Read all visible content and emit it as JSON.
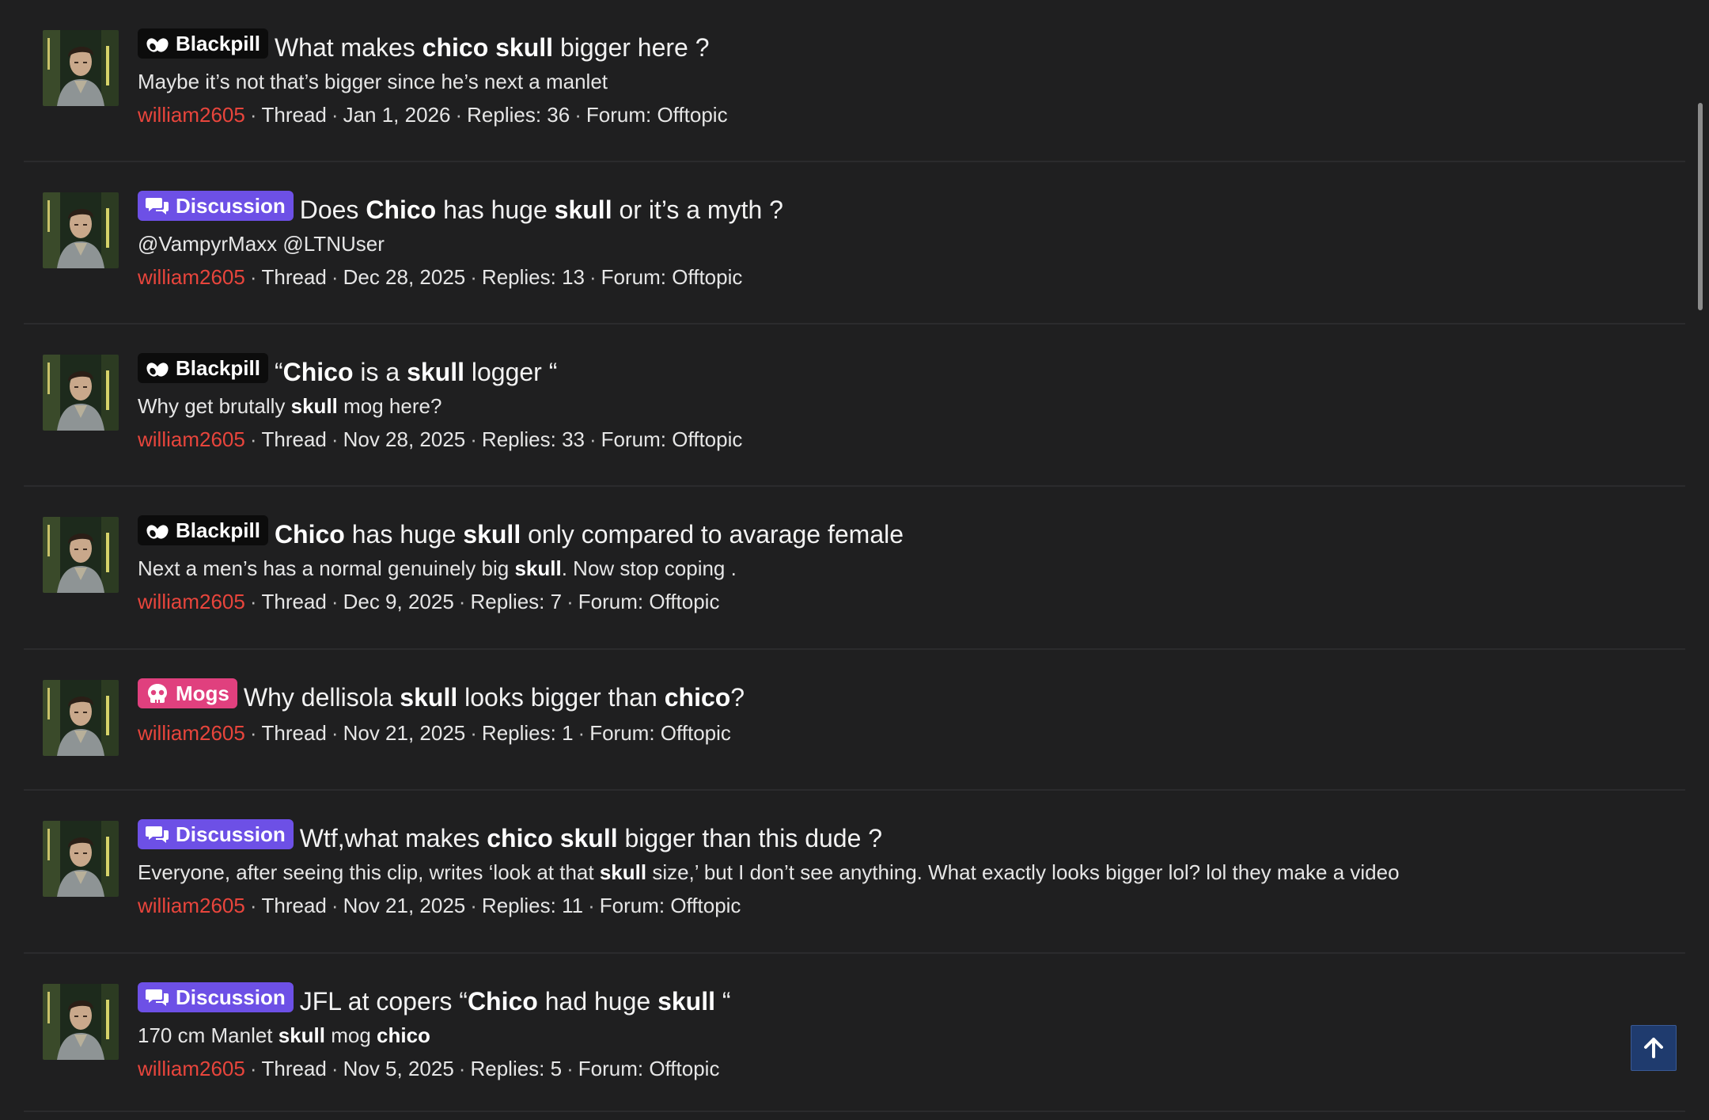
{
  "colors": {
    "background": "#1f1f20",
    "username": "#e8453c",
    "badge_blackpill": "#0c0c0c",
    "badge_discussion": "#6d50e6",
    "badge_mogs": "#e0407e",
    "back_to_top": "#1f3b6e"
  },
  "results": [
    {
      "badge": {
        "label": "Blackpill",
        "icon": "pill-icon",
        "kind": "blackpill"
      },
      "title": [
        {
          "t": "What makes "
        },
        {
          "t": "chico",
          "b": true
        },
        {
          "t": " "
        },
        {
          "t": "skull",
          "b": true
        },
        {
          "t": " bigger here ?"
        }
      ],
      "snippet": [
        {
          "t": "Maybe it’s not that’s bigger since he’s next a manlet"
        }
      ],
      "user": "william2605",
      "type": "Thread",
      "date": "Jan 1, 2026",
      "replies": "Replies: 36",
      "forum": "Forum: Offtopic"
    },
    {
      "badge": {
        "label": "Discussion",
        "icon": "chat-icon",
        "kind": "discussion"
      },
      "title": [
        {
          "t": "Does "
        },
        {
          "t": "Chico",
          "b": true
        },
        {
          "t": " has huge "
        },
        {
          "t": "skull",
          "b": true
        },
        {
          "t": " or it’s a myth ?"
        }
      ],
      "snippet": [
        {
          "t": "@VampyrMaxx @LTNUser"
        }
      ],
      "user": "william2605",
      "type": "Thread",
      "date": "Dec 28, 2025",
      "replies": "Replies: 13",
      "forum": "Forum: Offtopic"
    },
    {
      "badge": {
        "label": "Blackpill",
        "icon": "pill-icon",
        "kind": "blackpill"
      },
      "title": [
        {
          "t": "“"
        },
        {
          "t": "Chico",
          "b": true
        },
        {
          "t": " is a "
        },
        {
          "t": "skull",
          "b": true
        },
        {
          "t": " logger “"
        }
      ],
      "snippet": [
        {
          "t": "Why get brutally "
        },
        {
          "t": "skull",
          "b": true
        },
        {
          "t": " mog here?"
        }
      ],
      "user": "william2605",
      "type": "Thread",
      "date": "Nov 28, 2025",
      "replies": "Replies: 33",
      "forum": "Forum: Offtopic"
    },
    {
      "badge": {
        "label": "Blackpill",
        "icon": "pill-icon",
        "kind": "blackpill"
      },
      "title": [
        {
          "t": "Chico",
          "b": true
        },
        {
          "t": " has huge "
        },
        {
          "t": "skull",
          "b": true
        },
        {
          "t": " only compared to avarage female"
        }
      ],
      "snippet": [
        {
          "t": "Next a men’s has a normal genuinely big "
        },
        {
          "t": "skull",
          "b": true
        },
        {
          "t": ". Now stop coping ."
        }
      ],
      "user": "william2605",
      "type": "Thread",
      "date": "Dec 9, 2025",
      "replies": "Replies: 7",
      "forum": "Forum: Offtopic"
    },
    {
      "badge": {
        "label": "Mogs",
        "icon": "skull-icon",
        "kind": "mogs"
      },
      "title": [
        {
          "t": "Why dellisola "
        },
        {
          "t": "skull",
          "b": true
        },
        {
          "t": " looks bigger than "
        },
        {
          "t": "chico",
          "b": true
        },
        {
          "t": "?"
        }
      ],
      "snippet": [],
      "user": "william2605",
      "type": "Thread",
      "date": "Nov 21, 2025",
      "replies": "Replies: 1",
      "forum": "Forum: Offtopic"
    },
    {
      "badge": {
        "label": "Discussion",
        "icon": "chat-icon",
        "kind": "discussion"
      },
      "title": [
        {
          "t": "Wtf,what makes "
        },
        {
          "t": "chico",
          "b": true
        },
        {
          "t": " "
        },
        {
          "t": "skull",
          "b": true
        },
        {
          "t": " bigger than this dude ?"
        }
      ],
      "snippet": [
        {
          "t": "Everyone, after seeing this clip, writes ‘look at that "
        },
        {
          "t": "skull",
          "b": true
        },
        {
          "t": " size,’ but I don’t see anything. What exactly looks bigger lol? lol they make a video"
        }
      ],
      "user": "william2605",
      "type": "Thread",
      "date": "Nov 21, 2025",
      "replies": "Replies: 11",
      "forum": "Forum: Offtopic"
    },
    {
      "badge": {
        "label": "Discussion",
        "icon": "chat-icon",
        "kind": "discussion"
      },
      "title": [
        {
          "t": "JFL at copers “"
        },
        {
          "t": "Chico",
          "b": true
        },
        {
          "t": " had huge "
        },
        {
          "t": "skull",
          "b": true
        },
        {
          "t": " “"
        }
      ],
      "snippet": [
        {
          "t": "170 cm Manlet "
        },
        {
          "t": "skull",
          "b": true
        },
        {
          "t": " mog "
        },
        {
          "t": "chico",
          "b": true
        }
      ],
      "user": "william2605",
      "type": "Thread",
      "date": "Nov 5, 2025",
      "replies": "Replies: 5",
      "forum": "Forum: Offtopic"
    }
  ],
  "back_to_top_icon": "arrow-up-icon",
  "separator": "·"
}
